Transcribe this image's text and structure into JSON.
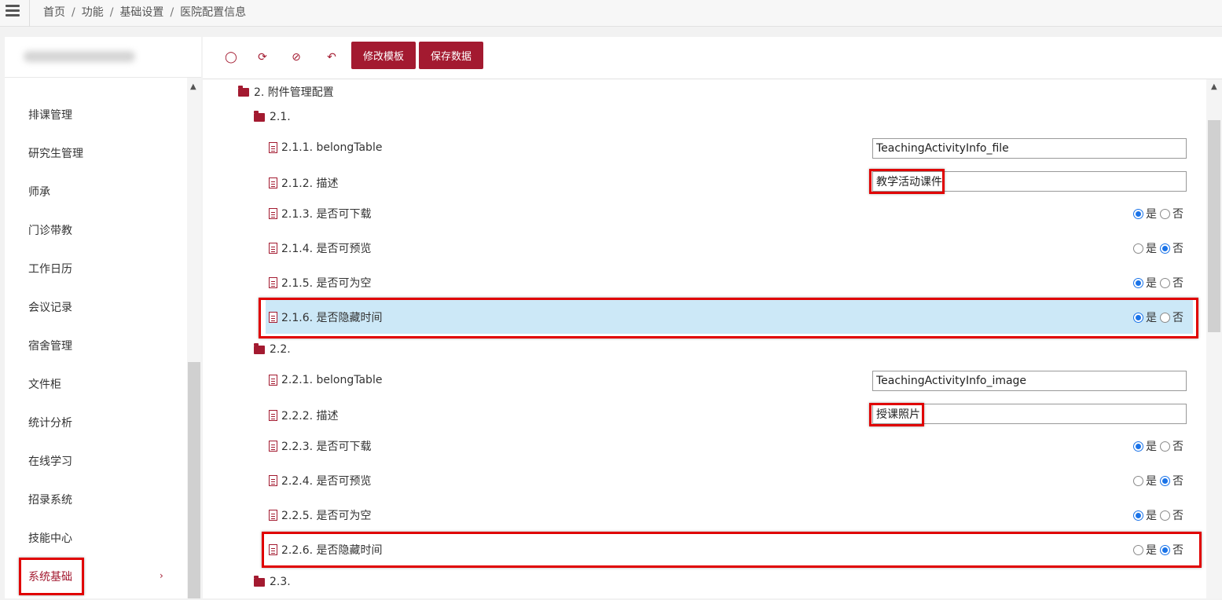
{
  "breadcrumb": [
    "首页",
    "功能",
    "基础设置",
    "医院配置信息"
  ],
  "sidebar": {
    "items": [
      "排课管理",
      "研究生管理",
      "师承",
      "门诊带教",
      "工作日历",
      "会议记录",
      "宿舍管理",
      "文件柜",
      "统计分析",
      "在线学习",
      "招录系统",
      "技能中心",
      "系统基础"
    ],
    "active": "系统基础",
    "chevron": "›"
  },
  "toolbar": {
    "icons": [
      "lightbulb-icon",
      "refresh-icon",
      "eye-slash-icon",
      "undo-icon"
    ],
    "edit_template_label": "修改模板",
    "save_data_label": "保存数据"
  },
  "colors": {
    "accent": "#a31a30",
    "selected_row": "#cce8f7",
    "highlight": "#e00000",
    "radio": "#1a73e8"
  },
  "tree": {
    "section": "2. 附件管理配置",
    "g1": {
      "label": "2.1.",
      "f1": {
        "label": "2.1.1. belongTable",
        "value": "TeachingActivityInfo_file"
      },
      "f2": {
        "label": "2.1.2. 描述",
        "value": "教学活动课件"
      },
      "f3": {
        "label": "2.1.3. 是否可下载",
        "yes": "是",
        "no": "否",
        "selected": "yes"
      },
      "f4": {
        "label": "2.1.4. 是否可预览",
        "yes": "是",
        "no": "否",
        "selected": "no"
      },
      "f5": {
        "label": "2.1.5. 是否可为空",
        "yes": "是",
        "no": "否",
        "selected": "yes"
      },
      "f6": {
        "label": "2.1.6. 是否隐藏时间",
        "yes": "是",
        "no": "否",
        "selected": "yes"
      }
    },
    "g2": {
      "label": "2.2.",
      "f1": {
        "label": "2.2.1. belongTable",
        "value": "TeachingActivityInfo_image"
      },
      "f2": {
        "label": "2.2.2. 描述",
        "value": "授课照片"
      },
      "f3": {
        "label": "2.2.3. 是否可下载",
        "yes": "是",
        "no": "否",
        "selected": "yes"
      },
      "f4": {
        "label": "2.2.4. 是否可预览",
        "yes": "是",
        "no": "否",
        "selected": "no"
      },
      "f5": {
        "label": "2.2.5. 是否可为空",
        "yes": "是",
        "no": "否",
        "selected": "yes"
      },
      "f6": {
        "label": "2.2.6. 是否隐藏时间",
        "yes": "是",
        "no": "否",
        "selected": "no"
      }
    },
    "g3": {
      "label": "2.3."
    }
  }
}
